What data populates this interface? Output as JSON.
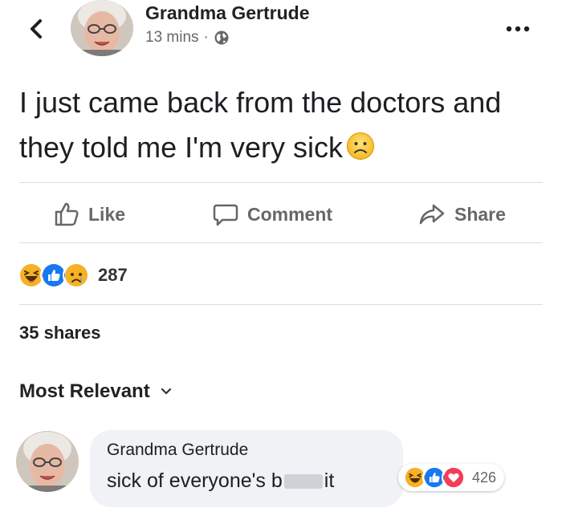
{
  "post": {
    "author": "Grandma Gertrude",
    "time": "13 mins",
    "separator": "·",
    "text": "I just came back from the doctors and they told me I'm very sick"
  },
  "actions": {
    "like": "Like",
    "comment": "Comment",
    "share": "Share"
  },
  "reactions": {
    "count": "287",
    "icons": [
      "haha-icon",
      "like-icon",
      "sad-icon"
    ]
  },
  "shares": "35 shares",
  "sort": {
    "label": "Most Relevant"
  },
  "comment": {
    "author": "Grandma Gertrude",
    "text_before": "sick of everyone's b",
    "text_after": "it",
    "reaction_count": "426",
    "icons": [
      "haha-icon",
      "like-icon",
      "love-icon"
    ]
  },
  "colors": {
    "like_blue": "#1877f2",
    "haha_yellow": "#f7b125",
    "love_red": "#f33e58",
    "muted_text": "#65676b",
    "bubble_bg": "#f0f2f5"
  }
}
